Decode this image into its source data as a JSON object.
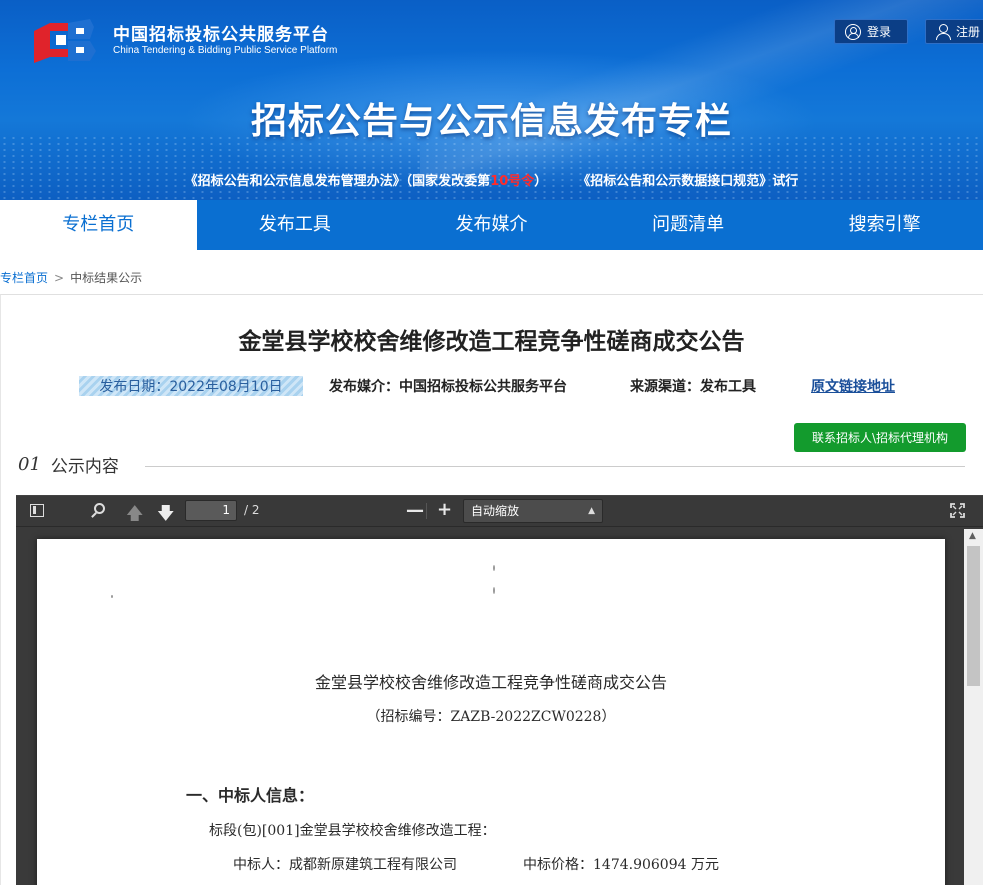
{
  "header": {
    "site_name_cn": "中国招标投标公共服务平台",
    "site_name_en": "China Tendering & Bidding Public Service Platform",
    "login_label": "登录",
    "register_label": "注册",
    "banner_title": "招标公告与公示信息发布专栏",
    "notice_part1": "《招标公告和公示信息发布管理办法》（国家发改委第",
    "notice_highlight": "10号令",
    "notice_part2": "）",
    "notice_part3": "《招标公告和公示数据接口规范》试行"
  },
  "nav": {
    "items": [
      {
        "label": "专栏首页"
      },
      {
        "label": "发布工具"
      },
      {
        "label": "发布媒介"
      },
      {
        "label": "问题清单"
      },
      {
        "label": "搜索引擎"
      }
    ]
  },
  "breadcrumb": {
    "home": "专栏首页",
    "separator": ">",
    "current": "中标结果公示"
  },
  "article": {
    "title": "金堂县学校校舍维修改造工程竞争性磋商成交公告",
    "date": "发布日期：2022年08月10日",
    "media": "发布媒介：中国招标投标公共服务平台",
    "source": "来源渠道：发布工具",
    "original_link": "原文链接地址",
    "contact_button": "联系招标人\\招标代理机构",
    "section_num": "01",
    "section_title": "公示内容"
  },
  "pdf_viewer": {
    "page_current": "1",
    "page_total": "/ 2",
    "zoom_option": "自动缩放",
    "doc": {
      "title": "金堂县学校校舍维修改造工程竞争性磋商成交公告",
      "code": "（招标编号：ZAZB-2022ZCW0228）",
      "heading1": "一、中标人信息：",
      "lot": "标段(包)[001]金堂县学校校舍维修改造工程：",
      "winner": "中标人：成都新原建筑工程有限公司",
      "price": "中标价格：1474.906094 万元"
    }
  },
  "colors": {
    "nav_blue": "#0a6fd1",
    "contact_green": "#139b2d",
    "notice_red": "#ff2b2b"
  }
}
